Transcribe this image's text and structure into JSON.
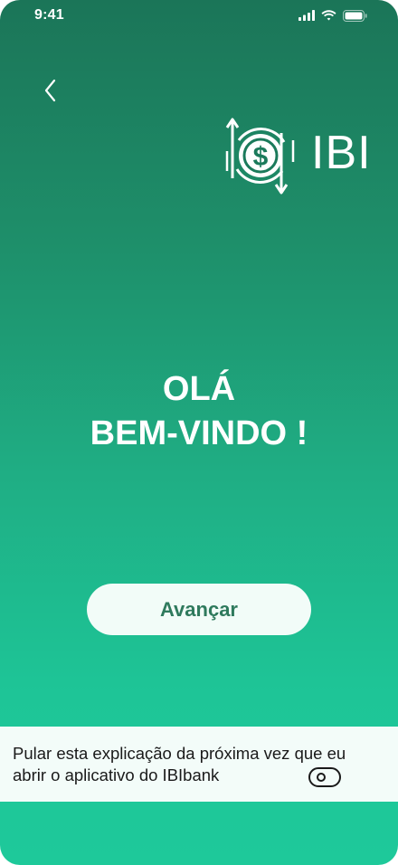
{
  "status_bar": {
    "time": "9:41",
    "icons": [
      "signal-icon",
      "wifi-icon",
      "battery-icon"
    ]
  },
  "header": {
    "back_icon": "chevron-left-icon",
    "logo_icon": "dollar-exchange-icon",
    "logo_text": "IBI"
  },
  "welcome": {
    "line1": "OLÁ",
    "line2": "BEM-VINDO !"
  },
  "actions": {
    "next_label": "Avançar"
  },
  "skip_option": {
    "text": "Pular esta explicação da próxima vez que eu abrir o aplicativo do IBIbank",
    "toggle_on": false
  },
  "colors": {
    "gradient_top": "#1b7558",
    "gradient_bottom": "#1ec99a",
    "button_bg": "#f2fcf8",
    "button_text": "#2f7a5d",
    "panel_bg": "#f3fcf9"
  }
}
